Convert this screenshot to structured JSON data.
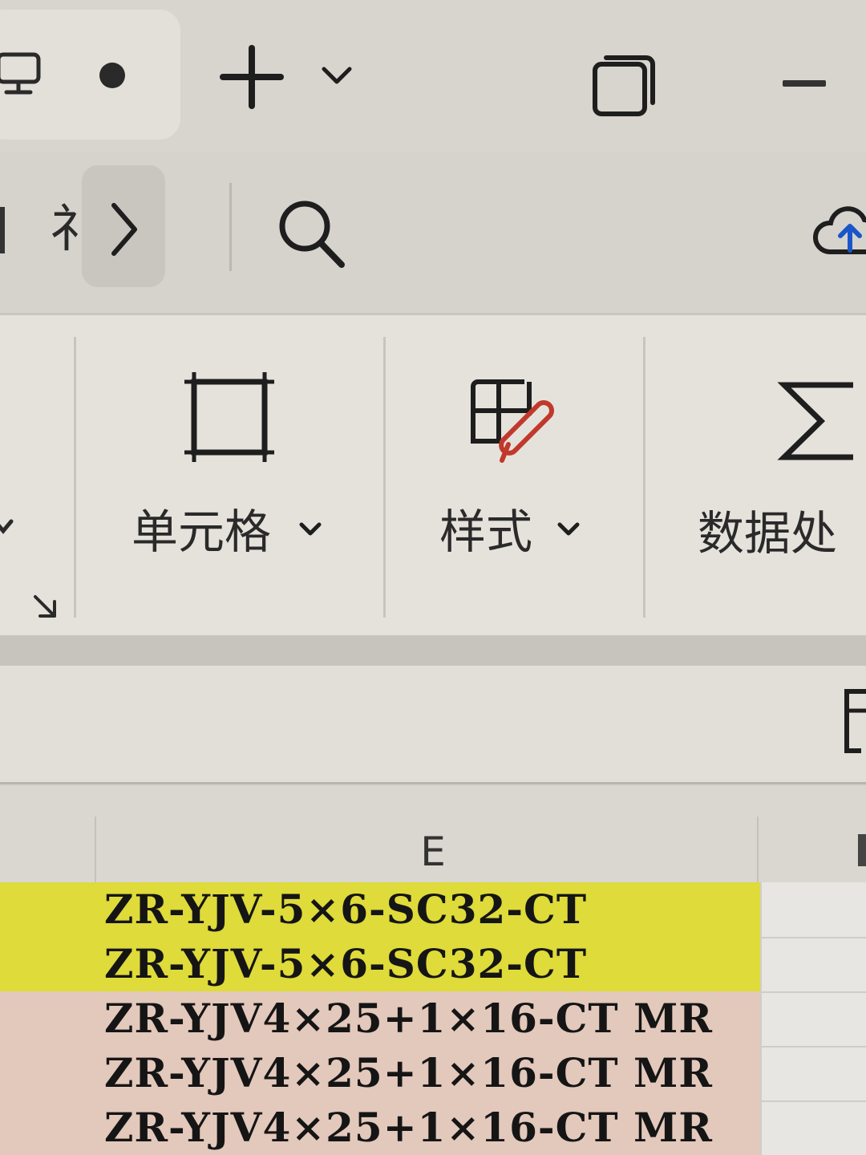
{
  "titlebar": {
    "new_tab_label": "+",
    "tab_active": true
  },
  "quickbar": {
    "partial_label": "礻"
  },
  "ribbon": {
    "groups": [
      {
        "label": "单元格",
        "icon": "cell-border-icon"
      },
      {
        "label": "样式",
        "icon": "table-style-brush-icon"
      },
      {
        "label": "数据处",
        "icon": "sigma-icon"
      }
    ]
  },
  "grid": {
    "column_header": "E",
    "rows": [
      {
        "text": "ZR-YJV-5×6-SC32-CT",
        "fill": "#dedb3a"
      },
      {
        "text": "ZR-YJV-5×6-SC32-CT",
        "fill": "#dedb3a"
      },
      {
        "text": "ZR-YJV4×25+1×16-CT MR",
        "fill": "#e3c8bc"
      },
      {
        "text": "ZR-YJV4×25+1×16-CT MR",
        "fill": "#e3c8bc"
      },
      {
        "text": "ZR-YJV4×25+1×16-CT MR",
        "fill": "#e3c8bc"
      }
    ]
  },
  "colors": {
    "accent_cloud": "#1a56c9",
    "brush_red": "#c0392b"
  }
}
